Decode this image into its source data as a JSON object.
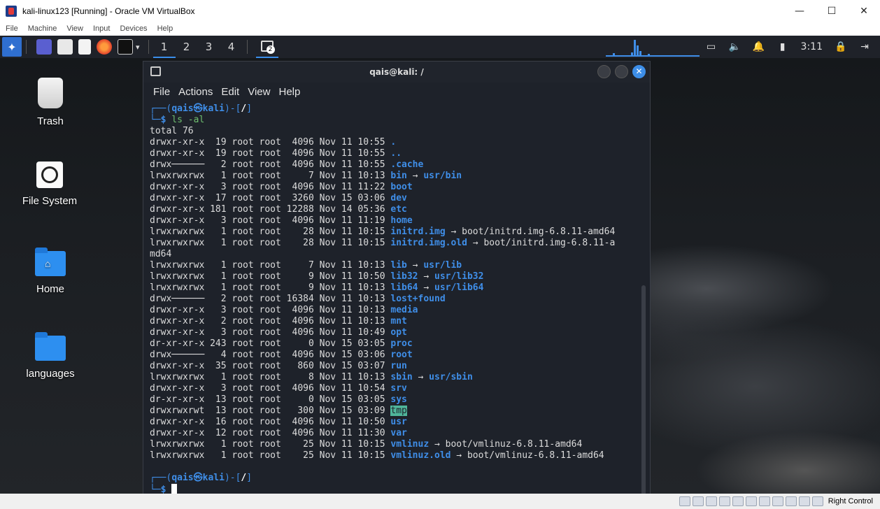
{
  "host": {
    "title": "kali-linux123 [Running] - Oracle VM VirtualBox",
    "menu": [
      "File",
      "Machine",
      "View",
      "Input",
      "Devices",
      "Help"
    ],
    "status_right": "Right Control"
  },
  "panel": {
    "workspaces": [
      "1",
      "2",
      "3",
      "4"
    ],
    "terminal_badge": "2",
    "clock": "3:11"
  },
  "desktop": {
    "icons": [
      {
        "label": "Trash",
        "icon": "trash-icon"
      },
      {
        "label": "File System",
        "icon": "drive-icon"
      },
      {
        "label": "Home",
        "icon": "home-folder-icon"
      },
      {
        "label": "languages",
        "icon": "folder-icon"
      }
    ]
  },
  "terminal": {
    "title": "qais@kali: /",
    "menu": [
      "File",
      "Actions",
      "Edit",
      "View",
      "Help"
    ],
    "prompt_user": "qais㉿kali",
    "prompt_dir": "/",
    "command": "ls -al",
    "total": "total 76",
    "entries": [
      {
        "meta": "drwxr-xr-x  19 root root  4096 Nov 11 10:55 ",
        "name": ".",
        "target": ""
      },
      {
        "meta": "drwxr-xr-x  19 root root  4096 Nov 11 10:55 ",
        "name": "..",
        "target": ""
      },
      {
        "meta": "drwx──────   2 root root  4096 Nov 11 10:55 ",
        "name": ".cache",
        "target": ""
      },
      {
        "meta": "lrwxrwxrwx   1 root root     7 Nov 11 10:13 ",
        "name": "bin",
        "target": "usr/bin"
      },
      {
        "meta": "drwxr-xr-x   3 root root  4096 Nov 11 11:22 ",
        "name": "boot",
        "target": ""
      },
      {
        "meta": "drwxr-xr-x  17 root root  3260 Nov 15 03:06 ",
        "name": "dev",
        "target": ""
      },
      {
        "meta": "drwxr-xr-x 181 root root 12288 Nov 14 05:36 ",
        "name": "etc",
        "target": ""
      },
      {
        "meta": "drwxr-xr-x   3 root root  4096 Nov 11 11:19 ",
        "name": "home",
        "target": ""
      },
      {
        "meta": "lrwxrwxrwx   1 root root    28 Nov 11 10:15 ",
        "name": "initrd.img",
        "target": "boot/initrd.img-6.8.11-amd64"
      },
      {
        "meta": "lrwxrwxrwx   1 root root    28 Nov 11 10:15 ",
        "name": "initrd.img.old",
        "target": "boot/initrd.img-6.8.11-a"
      },
      {
        "meta": "",
        "name": "",
        "target": "",
        "wrap": "md64"
      },
      {
        "meta": "lrwxrwxrwx   1 root root     7 Nov 11 10:13 ",
        "name": "lib",
        "target": "usr/lib"
      },
      {
        "meta": "lrwxrwxrwx   1 root root     9 Nov 11 10:50 ",
        "name": "lib32",
        "target": "usr/lib32"
      },
      {
        "meta": "lrwxrwxrwx   1 root root     9 Nov 11 10:13 ",
        "name": "lib64",
        "target": "usr/lib64"
      },
      {
        "meta": "drwx──────   2 root root 16384 Nov 11 10:13 ",
        "name": "lost+found",
        "target": ""
      },
      {
        "meta": "drwxr-xr-x   3 root root  4096 Nov 11 10:13 ",
        "name": "media",
        "target": ""
      },
      {
        "meta": "drwxr-xr-x   2 root root  4096 Nov 11 10:13 ",
        "name": "mnt",
        "target": ""
      },
      {
        "meta": "drwxr-xr-x   3 root root  4096 Nov 11 10:49 ",
        "name": "opt",
        "target": ""
      },
      {
        "meta": "dr-xr-xr-x 243 root root     0 Nov 15 03:05 ",
        "name": "proc",
        "target": ""
      },
      {
        "meta": "drwx──────   4 root root  4096 Nov 15 03:06 ",
        "name": "root",
        "target": ""
      },
      {
        "meta": "drwxr-xr-x  35 root root   860 Nov 15 03:07 ",
        "name": "run",
        "target": ""
      },
      {
        "meta": "lrwxrwxrwx   1 root root     8 Nov 11 10:13 ",
        "name": "sbin",
        "target": "usr/sbin"
      },
      {
        "meta": "drwxr-xr-x   3 root root  4096 Nov 11 10:54 ",
        "name": "srv",
        "target": ""
      },
      {
        "meta": "dr-xr-xr-x  13 root root     0 Nov 15 03:05 ",
        "name": "sys",
        "target": ""
      },
      {
        "meta": "drwxrwxrwt  13 root root   300 Nov 15 03:09 ",
        "name": "tmp",
        "target": "",
        "highlight": true
      },
      {
        "meta": "drwxr-xr-x  16 root root  4096 Nov 11 10:50 ",
        "name": "usr",
        "target": ""
      },
      {
        "meta": "drwxr-xr-x  12 root root  4096 Nov 11 11:30 ",
        "name": "var",
        "target": ""
      },
      {
        "meta": "lrwxrwxrwx   1 root root    25 Nov 11 10:15 ",
        "name": "vmlinuz",
        "target": "boot/vmlinuz-6.8.11-amd64"
      },
      {
        "meta": "lrwxrwxrwx   1 root root    25 Nov 11 10:15 ",
        "name": "vmlinuz.old",
        "target": "boot/vmlinuz-6.8.11-amd64"
      }
    ]
  },
  "colors": {
    "accent": "#3f8ee8",
    "terminal_bg": "#1e222a",
    "panel_bg": "#1f2229",
    "tmp_highlight": "#4fb59a"
  }
}
